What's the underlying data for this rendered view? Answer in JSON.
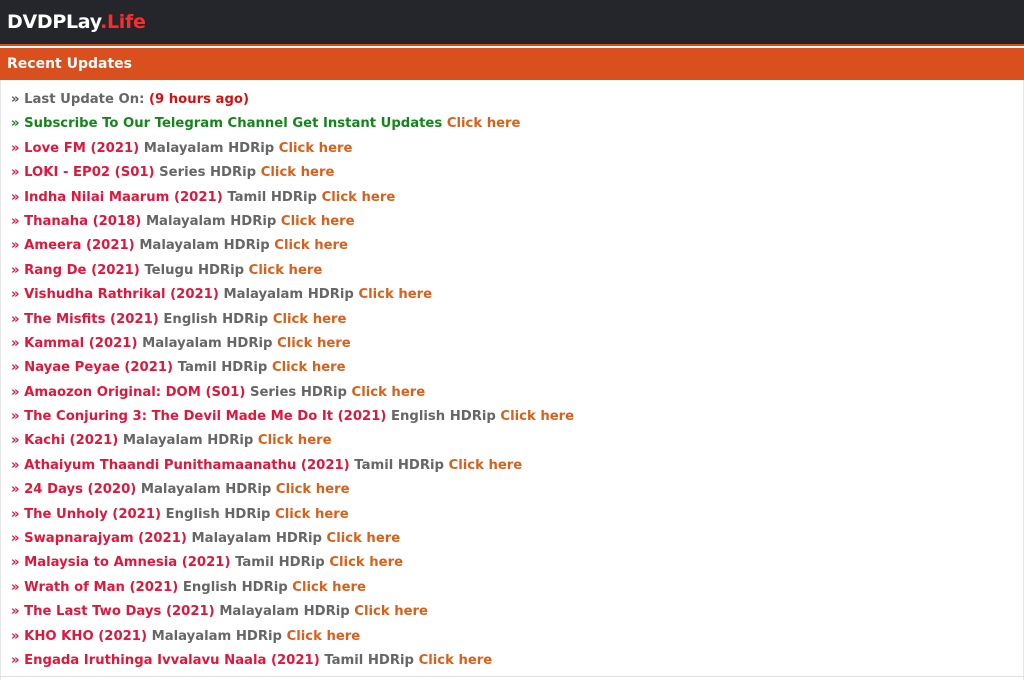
{
  "header": {
    "brand": "DVDPLay",
    "tld": ".Life"
  },
  "section": {
    "title": "Recent Updates"
  },
  "last_update": {
    "label": "Last Update On:",
    "value": "(9 hours ago)"
  },
  "subscribe": {
    "text": "Subscribe To Our Telegram Channel Get Instant Updates",
    "link": "Click here"
  },
  "link_label": "Click here",
  "bullet": "»",
  "updates": [
    {
      "title": "Love FM (2021)",
      "info": "Malayalam HDRip"
    },
    {
      "title": "LOKI - EP02 (S01)",
      "info": "Series HDRip"
    },
    {
      "title": "Indha Nilai Maarum (2021)",
      "info": "Tamil HDRip"
    },
    {
      "title": "Thanaha (2018)",
      "info": "Malayalam HDRip"
    },
    {
      "title": "Ameera (2021)",
      "info": "Malayalam HDRip"
    },
    {
      "title": "Rang De (2021)",
      "info": "Telugu HDRip"
    },
    {
      "title": "Vishudha Rathrikal (2021)",
      "info": "Malayalam HDRip"
    },
    {
      "title": "The Misfits (2021)",
      "info": "English HDRip"
    },
    {
      "title": "Kammal (2021)",
      "info": "Malayalam HDRip"
    },
    {
      "title": "Nayae Peyae (2021)",
      "info": "Tamil HDRip"
    },
    {
      "title": "Amaozon Original: DOM (S01)",
      "info": "Series HDRip"
    },
    {
      "title": "The Conjuring 3: The Devil Made Me Do It (2021)",
      "info": "English HDRip"
    },
    {
      "title": "Kachi (2021)",
      "info": "Malayalam HDRip"
    },
    {
      "title": "Athaiyum Thaandi Punithamaanathu (2021)",
      "info": "Tamil HDRip"
    },
    {
      "title": "24 Days (2020)",
      "info": "Malayalam HDRip"
    },
    {
      "title": "The Unholy (2021)",
      "info": "English HDRip"
    },
    {
      "title": "Swapnarajyam (2021)",
      "info": "Malayalam HDRip"
    },
    {
      "title": "Malaysia to Amnesia (2021)",
      "info": "Tamil HDRip"
    },
    {
      "title": "Wrath of Man (2021)",
      "info": "English HDRip"
    },
    {
      "title": "The Last Two Days (2021)",
      "info": "Malayalam HDRip"
    },
    {
      "title": "KHO KHO (2021)",
      "info": "Malayalam HDRip"
    },
    {
      "title": "Engada Iruthinga Ivvalavu Naala (2021)",
      "info": "Tamil HDRip"
    }
  ]
}
